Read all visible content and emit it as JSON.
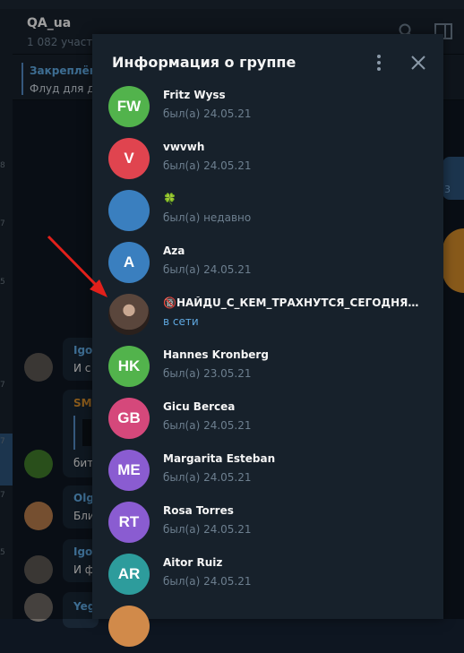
{
  "chat": {
    "title": "QA_ua",
    "subtitle": "1 082 участн",
    "pinned_title": "Закреплён",
    "pinned_text": "Флуд для ду"
  },
  "background_messages": [
    {
      "name": "Igo",
      "text": "И с",
      "name_color": "#5fa8e0"
    },
    {
      "name": "SM",
      "text": "бит",
      "name_color": "#d18a2a"
    },
    {
      "name": "Olg",
      "text": "Бли",
      "name_color": "#5fa8e0"
    },
    {
      "name": "Igo",
      "text": "И ф",
      "name_color": "#5fa8e0"
    },
    {
      "name": "Yeg",
      "text": "",
      "name_color": "#5fa8e0"
    }
  ],
  "left_numbers": [
    "8",
    "7",
    "5",
    "7",
    "7",
    "7",
    "5"
  ],
  "right_count": "3",
  "modal": {
    "title": "Информация о группе"
  },
  "members": [
    {
      "initials": "FW",
      "name": "Fritz Wyss",
      "status": "был(а) 24.05.21",
      "color": "#52b34c"
    },
    {
      "initials": "V",
      "name": "vwvwh",
      "status": "был(а) 24.05.21",
      "color": "#e0444f"
    },
    {
      "initials": "",
      "name": "🍀",
      "status": "был(а) недавно",
      "color": "#3a7fbf"
    },
    {
      "initials": "A",
      "name": "Aza",
      "status": "был(а) 24.05.21",
      "color": "#3a7fbf"
    },
    {
      "initials": "",
      "name": "🔞НАЙДU_С_КЕМ_ТРАХНУТСЯ_СЕГОДНЯ🔞🔞",
      "status": "в сети",
      "color": "#4a3a32",
      "photo": true,
      "online": true
    },
    {
      "initials": "HK",
      "name": "Hannes Kronberg",
      "status": "был(а) 23.05.21",
      "color": "#52b34c"
    },
    {
      "initials": "GB",
      "name": "Gicu Bercea",
      "status": "был(а) 24.05.21",
      "color": "#d5487b"
    },
    {
      "initials": "ME",
      "name": "Margarita Esteban",
      "status": "был(а) 24.05.21",
      "color": "#8a5cd1"
    },
    {
      "initials": "RT",
      "name": "Rosa Torres",
      "status": "был(а) 24.05.21",
      "color": "#8a5cd1"
    },
    {
      "initials": "AR",
      "name": "Aitor Ruiz",
      "status": "был(а) 24.05.21",
      "color": "#2d9c9c"
    },
    {
      "initials": "",
      "name": "",
      "status": "",
      "color": "#d18a4a"
    }
  ],
  "annotation": {
    "arrow_color": "#e3201b"
  }
}
